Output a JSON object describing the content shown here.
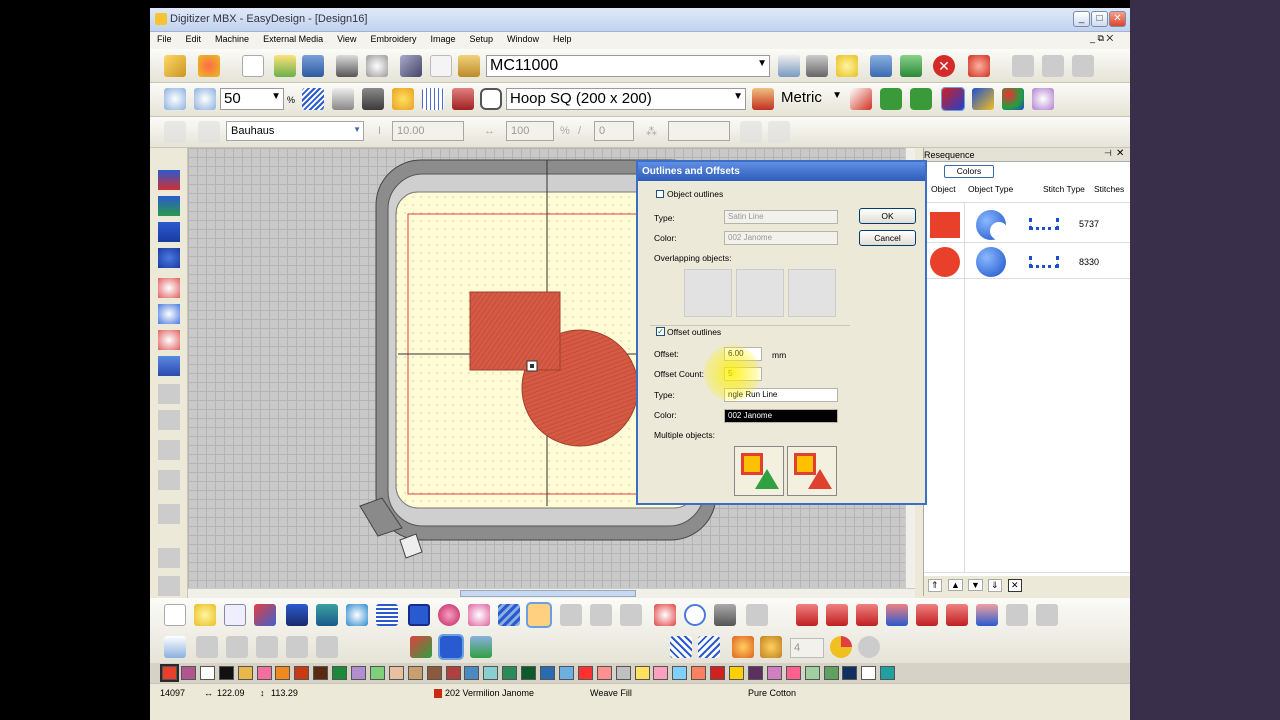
{
  "window": {
    "title": "Digitizer MBX - EasyDesign - [Design16]"
  },
  "menu": [
    "File",
    "Edit",
    "Machine",
    "External Media",
    "View",
    "Embroidery",
    "Image",
    "Setup",
    "Window",
    "Help"
  ],
  "toolbar": {
    "machine": "MC11000",
    "zoom": "50",
    "zoom_unit": "%",
    "hoop": "Hoop SQ (200 x 200)",
    "units": "Metric"
  },
  "text_toolbar": {
    "font": "Bauhaus",
    "height": "10.00",
    "width": "100",
    "slant": "0"
  },
  "resequence": {
    "title": "Resequence",
    "colors_button": "Colors",
    "columns": [
      "Object",
      "Object Type",
      "Stitch Type",
      "Stitches"
    ],
    "rows": [
      {
        "object_color": "#e8402a",
        "shape": "square",
        "type_icon": "satin-crescent-icon",
        "stitch_icon": "run-stitch-icon",
        "stitches": "5737"
      },
      {
        "object_color": "#e8402a",
        "shape": "circle",
        "type_icon": "circle-fill-icon",
        "stitch_icon": "run-stitch-icon",
        "stitches": "8330"
      }
    ]
  },
  "dialog": {
    "title": "Outlines and Offsets",
    "object_outlines_label": "Object outlines",
    "object_outlines_checked": false,
    "type_label": "Type:",
    "type_value_disabled": "Satin Line",
    "color_label": "Color:",
    "color_value_disabled": "002 Janome",
    "overlapping_label": "Overlapping objects:",
    "offset_outlines_label": "Offset outlines",
    "offset_outlines_checked": true,
    "offset_label": "Offset:",
    "offset_value": "6.00",
    "offset_unit": "mm",
    "offset_count_label": "Offset Count:",
    "offset_count_value": "5",
    "type2_label": "Type:",
    "type2_value": "ngle Run Line",
    "color2_label": "Color:",
    "color2_value": "002 Janome",
    "multiple_label": "Multiple objects:",
    "ok": "OK",
    "cancel": "Cancel"
  },
  "palette": [
    "#e8402a",
    "#b05590",
    "#ffffff",
    "#111111",
    "#e8b84a",
    "#f36fa0",
    "#f08a1e",
    "#c83a14",
    "#5a2a10",
    "#1a8a3a",
    "#b08fd0",
    "#7ed07a",
    "#e8c0a0",
    "#c8a070",
    "#8a5a3a",
    "#b04040",
    "#4a8ac0",
    "#8ad0d0",
    "#2a8a5a",
    "#0a5a2a",
    "#2a6ab0",
    "#6ab0e0",
    "#ff3030",
    "#ff9090",
    "#c0c0c0",
    "#ffe060",
    "#ffa0c0",
    "#80d0ff",
    "#ff8060",
    "#d02020",
    "#ffd000",
    "#5a3060",
    "#d080c0",
    "#ff6090",
    "#a0d0a0",
    "#60a060",
    "#103060",
    "#ffffff",
    "#20a0a0"
  ],
  "status": {
    "stitches": "14097",
    "width": "122.09",
    "height": "113.29",
    "color": "202 Vermilion Janome",
    "fill": "Weave Fill",
    "fabric": "Pure Cotton"
  },
  "zoom_stepper": "4"
}
